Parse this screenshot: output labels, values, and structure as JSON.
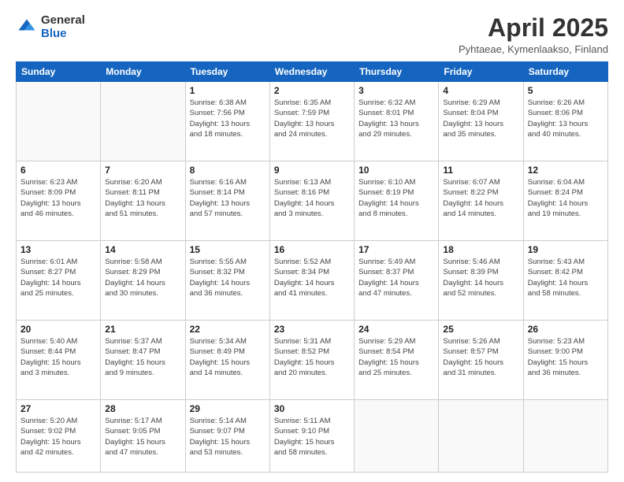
{
  "logo": {
    "general": "General",
    "blue": "Blue"
  },
  "header": {
    "title": "April 2025",
    "location": "Pyhtaeae, Kymenlaakso, Finland"
  },
  "days_of_week": [
    "Sunday",
    "Monday",
    "Tuesday",
    "Wednesday",
    "Thursday",
    "Friday",
    "Saturday"
  ],
  "weeks": [
    [
      {
        "day": "",
        "info": ""
      },
      {
        "day": "",
        "info": ""
      },
      {
        "day": "1",
        "info": "Sunrise: 6:38 AM\nSunset: 7:56 PM\nDaylight: 13 hours\nand 18 minutes."
      },
      {
        "day": "2",
        "info": "Sunrise: 6:35 AM\nSunset: 7:59 PM\nDaylight: 13 hours\nand 24 minutes."
      },
      {
        "day": "3",
        "info": "Sunrise: 6:32 AM\nSunset: 8:01 PM\nDaylight: 13 hours\nand 29 minutes."
      },
      {
        "day": "4",
        "info": "Sunrise: 6:29 AM\nSunset: 8:04 PM\nDaylight: 13 hours\nand 35 minutes."
      },
      {
        "day": "5",
        "info": "Sunrise: 6:26 AM\nSunset: 8:06 PM\nDaylight: 13 hours\nand 40 minutes."
      }
    ],
    [
      {
        "day": "6",
        "info": "Sunrise: 6:23 AM\nSunset: 8:09 PM\nDaylight: 13 hours\nand 46 minutes."
      },
      {
        "day": "7",
        "info": "Sunrise: 6:20 AM\nSunset: 8:11 PM\nDaylight: 13 hours\nand 51 minutes."
      },
      {
        "day": "8",
        "info": "Sunrise: 6:16 AM\nSunset: 8:14 PM\nDaylight: 13 hours\nand 57 minutes."
      },
      {
        "day": "9",
        "info": "Sunrise: 6:13 AM\nSunset: 8:16 PM\nDaylight: 14 hours\nand 3 minutes."
      },
      {
        "day": "10",
        "info": "Sunrise: 6:10 AM\nSunset: 8:19 PM\nDaylight: 14 hours\nand 8 minutes."
      },
      {
        "day": "11",
        "info": "Sunrise: 6:07 AM\nSunset: 8:22 PM\nDaylight: 14 hours\nand 14 minutes."
      },
      {
        "day": "12",
        "info": "Sunrise: 6:04 AM\nSunset: 8:24 PM\nDaylight: 14 hours\nand 19 minutes."
      }
    ],
    [
      {
        "day": "13",
        "info": "Sunrise: 6:01 AM\nSunset: 8:27 PM\nDaylight: 14 hours\nand 25 minutes."
      },
      {
        "day": "14",
        "info": "Sunrise: 5:58 AM\nSunset: 8:29 PM\nDaylight: 14 hours\nand 30 minutes."
      },
      {
        "day": "15",
        "info": "Sunrise: 5:55 AM\nSunset: 8:32 PM\nDaylight: 14 hours\nand 36 minutes."
      },
      {
        "day": "16",
        "info": "Sunrise: 5:52 AM\nSunset: 8:34 PM\nDaylight: 14 hours\nand 41 minutes."
      },
      {
        "day": "17",
        "info": "Sunrise: 5:49 AM\nSunset: 8:37 PM\nDaylight: 14 hours\nand 47 minutes."
      },
      {
        "day": "18",
        "info": "Sunrise: 5:46 AM\nSunset: 8:39 PM\nDaylight: 14 hours\nand 52 minutes."
      },
      {
        "day": "19",
        "info": "Sunrise: 5:43 AM\nSunset: 8:42 PM\nDaylight: 14 hours\nand 58 minutes."
      }
    ],
    [
      {
        "day": "20",
        "info": "Sunrise: 5:40 AM\nSunset: 8:44 PM\nDaylight: 15 hours\nand 3 minutes."
      },
      {
        "day": "21",
        "info": "Sunrise: 5:37 AM\nSunset: 8:47 PM\nDaylight: 15 hours\nand 9 minutes."
      },
      {
        "day": "22",
        "info": "Sunrise: 5:34 AM\nSunset: 8:49 PM\nDaylight: 15 hours\nand 14 minutes."
      },
      {
        "day": "23",
        "info": "Sunrise: 5:31 AM\nSunset: 8:52 PM\nDaylight: 15 hours\nand 20 minutes."
      },
      {
        "day": "24",
        "info": "Sunrise: 5:29 AM\nSunset: 8:54 PM\nDaylight: 15 hours\nand 25 minutes."
      },
      {
        "day": "25",
        "info": "Sunrise: 5:26 AM\nSunset: 8:57 PM\nDaylight: 15 hours\nand 31 minutes."
      },
      {
        "day": "26",
        "info": "Sunrise: 5:23 AM\nSunset: 9:00 PM\nDaylight: 15 hours\nand 36 minutes."
      }
    ],
    [
      {
        "day": "27",
        "info": "Sunrise: 5:20 AM\nSunset: 9:02 PM\nDaylight: 15 hours\nand 42 minutes."
      },
      {
        "day": "28",
        "info": "Sunrise: 5:17 AM\nSunset: 9:05 PM\nDaylight: 15 hours\nand 47 minutes."
      },
      {
        "day": "29",
        "info": "Sunrise: 5:14 AM\nSunset: 9:07 PM\nDaylight: 15 hours\nand 53 minutes."
      },
      {
        "day": "30",
        "info": "Sunrise: 5:11 AM\nSunset: 9:10 PM\nDaylight: 15 hours\nand 58 minutes."
      },
      {
        "day": "",
        "info": ""
      },
      {
        "day": "",
        "info": ""
      },
      {
        "day": "",
        "info": ""
      }
    ]
  ]
}
